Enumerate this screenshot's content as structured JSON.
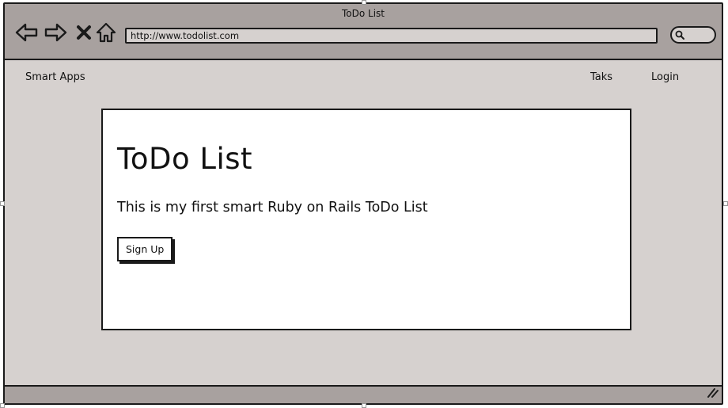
{
  "window": {
    "title": "ToDo List",
    "url": "http://www.todolist.com"
  },
  "toolbar": {
    "back_icon": "back-arrow-icon",
    "forward_icon": "forward-arrow-icon",
    "stop_icon": "close-icon",
    "home_icon": "home-icon",
    "search_icon": "search-icon"
  },
  "header": {
    "brand": "Smart Apps",
    "links": [
      "Taks",
      "Login"
    ]
  },
  "main": {
    "title": "ToDo List",
    "subtitle": "This is my first smart Ruby on Rails ToDo List",
    "signup_label": "Sign Up"
  },
  "colors": {
    "chrome": "#a8a19f",
    "page_background": "#d6d1cf",
    "card_background": "#ffffff",
    "ink": "#1a1a1a"
  }
}
